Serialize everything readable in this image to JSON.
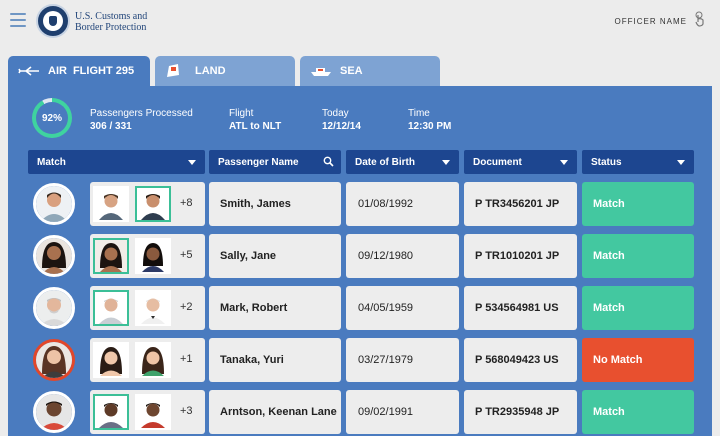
{
  "header": {
    "agency_line1": "U.S. Customs and",
    "agency_line2": "Border Protection",
    "officer_name": "OFFICER NAME"
  },
  "tabs": [
    {
      "label": "AIR",
      "sub": "FLIGHT 295",
      "icon": "plane-icon",
      "active": true
    },
    {
      "label": "LAND",
      "sub": "",
      "icon": "truck-icon",
      "active": false
    },
    {
      "label": "SEA",
      "sub": "",
      "icon": "ship-icon",
      "active": false
    }
  ],
  "summary": {
    "percent_text": "92%",
    "percent_value": 0.92,
    "processed_label": "Passengers Processed",
    "processed_value": "306 / 331",
    "flight_label": "Flight",
    "flight_value": "ATL to NLT",
    "today_label": "Today",
    "today_value": "12/12/14",
    "time_label": "Time",
    "time_value": "12:30 PM"
  },
  "columns": {
    "match": "Match",
    "name": "Passenger Name",
    "dob": "Date of Birth",
    "document": "Document",
    "status": "Status"
  },
  "rows": [
    {
      "more": "+8",
      "name": "Smith, James",
      "dob": "01/08/1992",
      "document": "P TR3456201 JP",
      "status": "Match"
    },
    {
      "more": "+5",
      "name": "Sally, Jane",
      "dob": "09/12/1980",
      "document": "P TR1010201 JP",
      "status": "Match"
    },
    {
      "more": "+2",
      "name": "Mark, Robert",
      "dob": "04/05/1959",
      "document": "P 534564981 US",
      "status": "Match"
    },
    {
      "more": "+1",
      "name": "Tanaka, Yuri",
      "dob": "03/27/1979",
      "document": "P 568049423 US",
      "status": "No Match"
    },
    {
      "more": "+3",
      "name": "Arntson, Keenan Lane",
      "dob": "09/02/1991",
      "document": "P TR2935948 JP",
      "status": "Match"
    }
  ],
  "colors": {
    "panel": "#4a7bbf",
    "header_blue": "#1d4690",
    "match_green": "#43c8a0",
    "no_match_red": "#e8502f",
    "selected_border": "#3bbf97"
  }
}
